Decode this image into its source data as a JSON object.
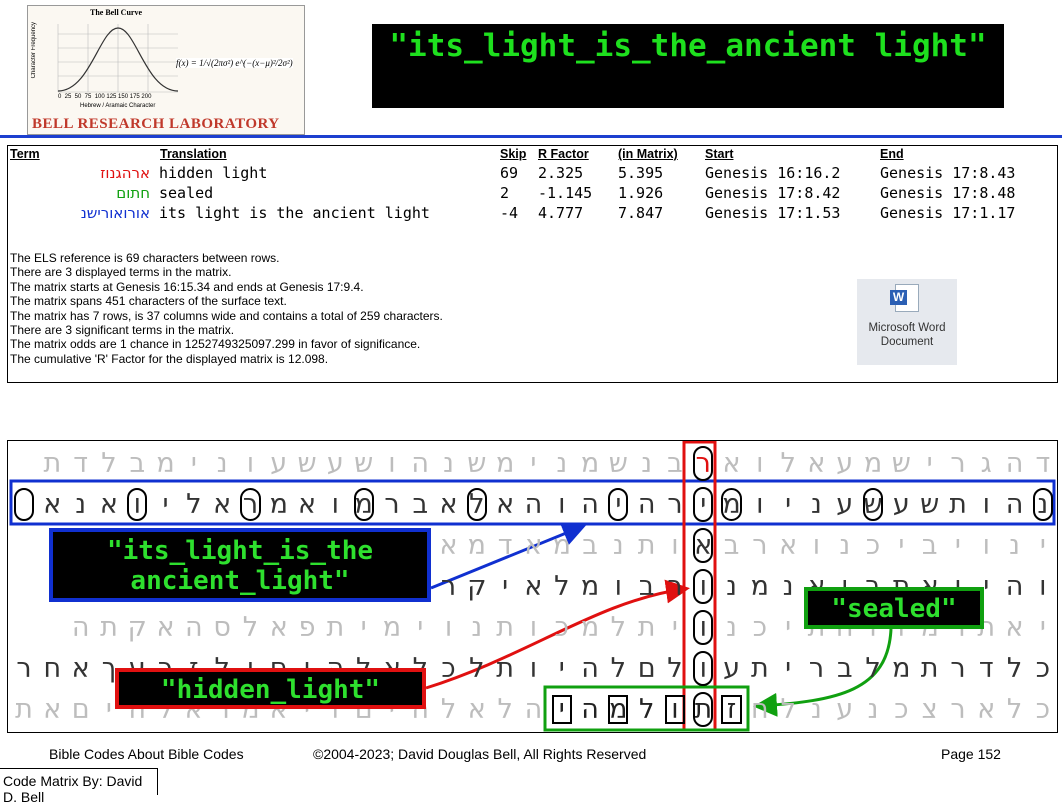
{
  "logo": {
    "title": "The Bell Curve",
    "formula": "f(x) = 1/√(2πσ²) e^(−(x−μ)²/2σ²)",
    "y_axis": "Character Frequency",
    "x_ticks": "0  25  50  75  100 125 150 175 200",
    "x_axis": "Hebrew / Aramaic Character",
    "lab_name": "BELL RESEARCH LABORATORY"
  },
  "title_banner": "\"its_light_is_the_ancient light\"",
  "terms_table": {
    "headers": [
      "Term",
      "Translation",
      "Skip",
      "R Factor",
      "(in Matrix)",
      "Start",
      "End"
    ],
    "rows": [
      {
        "term": "ארהגנוז",
        "translation": "hidden light",
        "skip": "69",
        "r_factor": "2.325",
        "in_matrix": "5.395",
        "start": "Genesis 16:16.2",
        "end": "Genesis 17:8.43",
        "color": "#e01010"
      },
      {
        "term": "חתום",
        "translation": "sealed",
        "skip": "2",
        "r_factor": "-1.145",
        "in_matrix": "1.926",
        "start": "Genesis 17:8.42",
        "end": "Genesis 17:8.48",
        "color": "#10a010"
      },
      {
        "term": "אורואורישנ",
        "translation": "its light is the ancient light",
        "skip": "-4",
        "r_factor": "4.777",
        "in_matrix": "7.847",
        "start": "Genesis 17:1.53",
        "end": "Genesis 17:1.17",
        "color": "#1030d0"
      }
    ]
  },
  "info_lines": [
    "The ELS reference is 69 characters between rows.",
    "There are 3 displayed terms in the matrix.",
    "The matrix starts at Genesis 16:15.34 and ends at Genesis 17:9.4.",
    "The matrix spans 451 characters of the surface text.",
    "The matrix has 7 rows, is 37 columns wide and contains a total of 259 characters.",
    "There are 3 significant terms in the matrix.",
    "The matrix odds are 1 chance in 1252749325097.299  in favor of significance.",
    "The cumulative 'R' Factor for the displayed matrix is 12.098."
  ],
  "word_icon": {
    "glyph": "W",
    "label_line1": "Microsoft Word",
    "label_line2": "Document"
  },
  "matrix": {
    "rows": [
      "דהגרישמעאלוארבנשמנימשנהושעשעונימבלדת",
      "נהותשעשעניומירהיהוהאלאברמואמראליואנא",
      "ינויביכנוארבאותנבמאדמאדויפלאברםעלפני",
      "והיואתביאנמנורבומלאיקראברםויהיאברה",
      "יאתרמווחתיכנויתלמכותנוימיתפאלסהאקתה",
      "כלדרתמלברית עולםלהיותלכלאלהיםולזרעךאחר",
      "כלארצכנענלחזתולמהיהלאלהיםויאמראלהיםאת"
    ],
    "labels": {
      "blue": "\"its_light_is_the ancient_light\"",
      "red": "\"hidden_light\"",
      "green": "\"sealed\""
    }
  },
  "footer": {
    "left": "Bible Codes About Bible Codes",
    "center": "©2004-2023; David Douglas Bell, All Rights Reserved",
    "right": "Page 152",
    "credit": "Code Matrix By: David D. Bell"
  }
}
